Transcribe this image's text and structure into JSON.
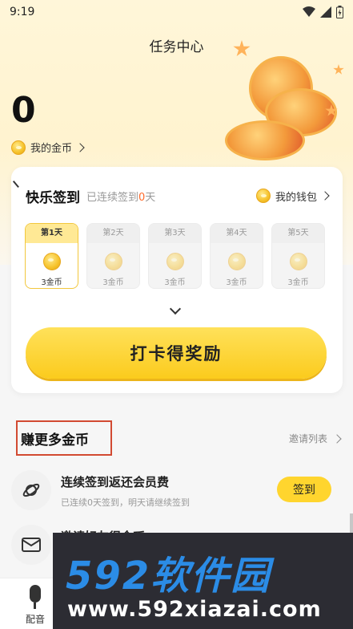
{
  "status_bar": {
    "time": "9:19"
  },
  "header": {
    "title": "任务中心",
    "coin_count": "0",
    "my_coins_label": "我的金币"
  },
  "checkin": {
    "title": "快乐签到",
    "streak_prefix": "已连续签到",
    "streak_days": "0",
    "streak_suffix": "天",
    "wallet_label": "我的钱包",
    "days": [
      {
        "label": "第1天",
        "amount": "3金币",
        "active": true
      },
      {
        "label": "第2天",
        "amount": "3金币",
        "active": false
      },
      {
        "label": "第3天",
        "amount": "3金币",
        "active": false
      },
      {
        "label": "第4天",
        "amount": "3金币",
        "active": false
      },
      {
        "label": "第5天",
        "amount": "3金币",
        "active": false
      }
    ],
    "button_label": "打卡得奖励"
  },
  "earn_more": {
    "title": "赚更多金币",
    "invite_list_label": "邀请列表",
    "tasks": [
      {
        "name": "连续签到返还会员费",
        "desc": "已连续0天签到，明天请继续签到",
        "button": "签到",
        "icon": "planet-icon"
      },
      {
        "name": "邀请好友得金币",
        "desc": "",
        "button": "",
        "icon": "mail-icon"
      }
    ]
  },
  "tabbar": {
    "voice_label": "配音"
  },
  "watermark": {
    "brand": "592软件园",
    "url": "www.592xiazai.com"
  },
  "colors": {
    "accent": "#ffd52e",
    "highlight": "#ff6a2a"
  }
}
